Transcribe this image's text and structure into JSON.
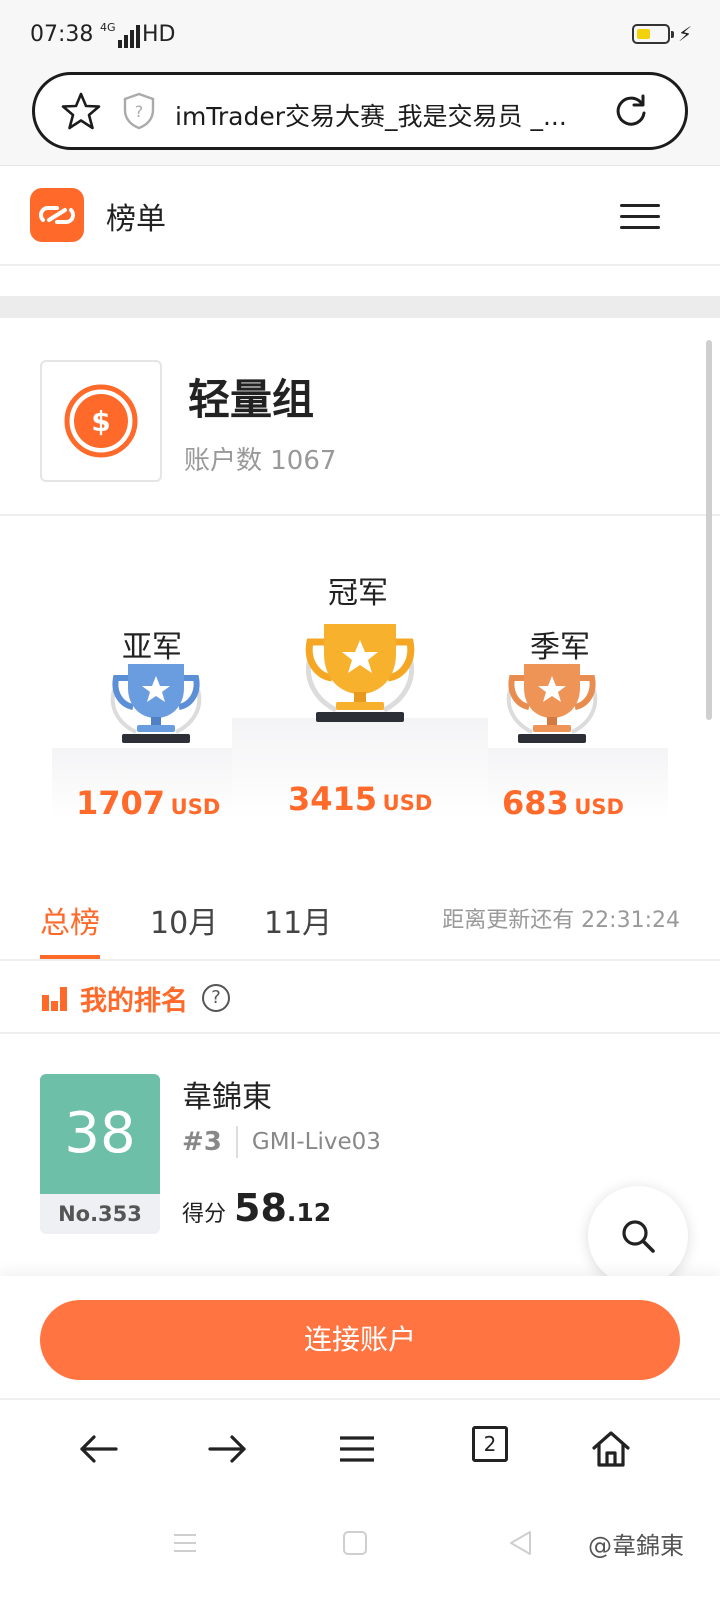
{
  "status_bar": {
    "time": "07:38",
    "network": "4G",
    "hd": "HD"
  },
  "url_bar": {
    "title": "imTrader交易大赛_我是交易员 _..."
  },
  "header": {
    "title": "榜单"
  },
  "group": {
    "name": "轻量组",
    "accounts": "账户数 1067"
  },
  "podium": {
    "second": {
      "label": "亚军",
      "amount": "1707",
      "currency": "USD"
    },
    "first": {
      "label": "冠军",
      "amount": "3415",
      "currency": "USD"
    },
    "third": {
      "label": "季军",
      "amount": "683",
      "currency": "USD"
    }
  },
  "tabs": [
    {
      "label": "总榜",
      "active": true
    },
    {
      "label": "10月",
      "active": false
    },
    {
      "label": "11月",
      "active": false
    }
  ],
  "countdown": "距离更新还有 22:31:24",
  "my_ranking": {
    "label": "我的排名",
    "help": "?"
  },
  "entry": {
    "position": "38",
    "number": "No.353",
    "name": "韋錦東",
    "rank": "#3",
    "account": "GMI-Live03",
    "score_label": "得分",
    "score_int": "58",
    "score_dec": ".12"
  },
  "connect_button": "连接账户",
  "browser_nav": {
    "tabs_count": "2"
  },
  "watermark": "@韋錦東",
  "colors": {
    "accent": "#ff6a2b",
    "badge": "#6dbfa7",
    "gold": "#f5a623",
    "silver": "#5b8fd6",
    "bronze": "#e98c4f"
  }
}
